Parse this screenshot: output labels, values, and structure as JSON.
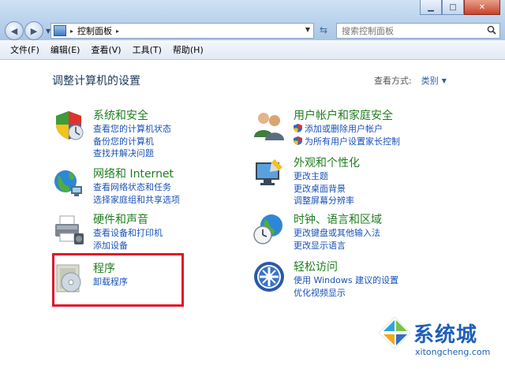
{
  "window": {
    "minimize_label": "▁",
    "maximize_label": "□",
    "close_label": "✕"
  },
  "address_bar": {
    "crumb": "控制面板",
    "separator": "▸"
  },
  "search": {
    "placeholder": "搜索控制面板"
  },
  "menu": [
    "文件(F)",
    "编辑(E)",
    "查看(V)",
    "工具(T)",
    "帮助(H)"
  ],
  "header": {
    "title": "调整计算机的设置",
    "view_by_label": "查看方式:",
    "view_by_value": "类别"
  },
  "categories": {
    "system": {
      "title": "系统和安全",
      "links": [
        "查看您的计算机状态",
        "备份您的计算机",
        "查找并解决问题"
      ]
    },
    "network": {
      "title": "网络和 Internet",
      "links": [
        "查看网络状态和任务",
        "选择家庭组和共享选项"
      ]
    },
    "hardware": {
      "title": "硬件和声音",
      "links": [
        "查看设备和打印机",
        "添加设备"
      ]
    },
    "programs": {
      "title": "程序",
      "links": [
        "卸载程序"
      ]
    },
    "users": {
      "title": "用户帐户和家庭安全",
      "links": [
        "添加或删除用户帐户",
        "为所有用户设置家长控制"
      ]
    },
    "appearance": {
      "title": "外观和个性化",
      "links": [
        "更改主题",
        "更改桌面背景",
        "调整屏幕分辨率"
      ]
    },
    "clock": {
      "title": "时钟、语言和区域",
      "links": [
        "更改键盘或其他输入法",
        "更改显示语言"
      ]
    },
    "ease": {
      "title": "轻松访问",
      "links": [
        "使用 Windows 建议的设置",
        "优化视频显示"
      ]
    }
  },
  "watermark": {
    "text": "系统城",
    "url": "xitongcheng.com"
  },
  "colors": {
    "category_title": "#1f7d1f",
    "link": "#1a52b8",
    "highlight": "#e0142a"
  }
}
